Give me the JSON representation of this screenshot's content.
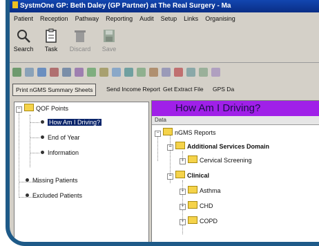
{
  "window": {
    "title": "SystmOne GP: Beth Daley (GP Partner) at The Real Surgery - Ma"
  },
  "menu": [
    "Patient",
    "Reception",
    "Pathway",
    "Reporting",
    "Audit",
    "Setup",
    "Links",
    "Organising"
  ],
  "toolbar": [
    {
      "label": "Search",
      "icon": "search-icon",
      "enabled": true
    },
    {
      "label": "Task",
      "icon": "task-icon",
      "enabled": true
    },
    {
      "label": "Discard",
      "icon": "discard-icon",
      "enabled": false
    },
    {
      "label": "Save",
      "icon": "save-icon",
      "enabled": false
    }
  ],
  "action_buttons": [
    "Print nGMS Summary Sheets",
    "Send Income Report",
    "Get Extract File",
    "GPS Da"
  ],
  "left_tree": {
    "root": "QOF Points",
    "children": [
      "How Am I Driving?",
      "End of Year",
      "Information"
    ],
    "others": [
      "Missing Patients",
      "Excluded Patients"
    ]
  },
  "right_panel": {
    "banner": "How Am I Driving?",
    "tab": "Data",
    "root": "nGMS Reports",
    "domains": [
      "Additional Services Domain",
      "Clinical"
    ],
    "additional_items": [
      "Cervical Screening"
    ],
    "clinical_items": [
      "Asthma",
      "CHD",
      "COPD"
    ]
  },
  "colors": {
    "title_bar": "#1246b0",
    "banner": "#a020e8",
    "frame": "#1e5a88",
    "selection": "#0a246a"
  }
}
